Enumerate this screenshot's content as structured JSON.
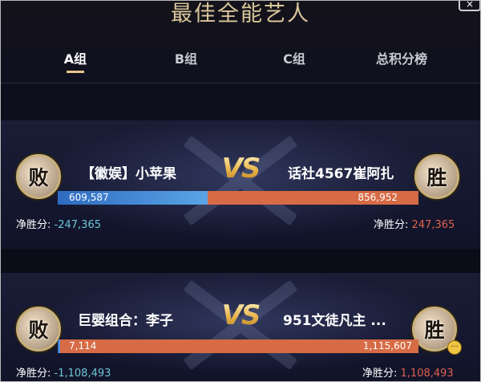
{
  "header": {
    "title": "最佳全能艺人",
    "tabs": [
      {
        "label": "A组",
        "active": true
      },
      {
        "label": "B组",
        "active": false
      },
      {
        "label": "C组",
        "active": false
      },
      {
        "label": "总积分榜",
        "active": false
      }
    ]
  },
  "colors": {
    "accent": "#e6c78b",
    "left_bar": "#4a8fd8",
    "right_bar": "#d66b45",
    "net_negative": "#6cc6d6",
    "net_positive": "#e0624f"
  },
  "matches": [
    {
      "left": {
        "name": "【徽娱】小苹果",
        "badge": "败",
        "score": "609,587",
        "net_label": "净胜分:",
        "net_value": "-247,365"
      },
      "right": {
        "name": "话社4567崔阿扎",
        "badge": "胜",
        "score": "856,952",
        "net_label": "净胜分:",
        "net_value": "247,365"
      },
      "vs": "VS",
      "left_share": 0.416
    },
    {
      "left": {
        "name": "巨婴组合：李子",
        "badge": "败",
        "score": "7,114",
        "net_label": "净胜分:",
        "net_value": "-1,108,493"
      },
      "right": {
        "name": "951文徒凡主 ...",
        "badge": "胜",
        "score": "1,115,607",
        "net_label": "净胜分:",
        "net_value": "1,108,493"
      },
      "vs": "VS",
      "left_share": 0.006
    }
  ]
}
